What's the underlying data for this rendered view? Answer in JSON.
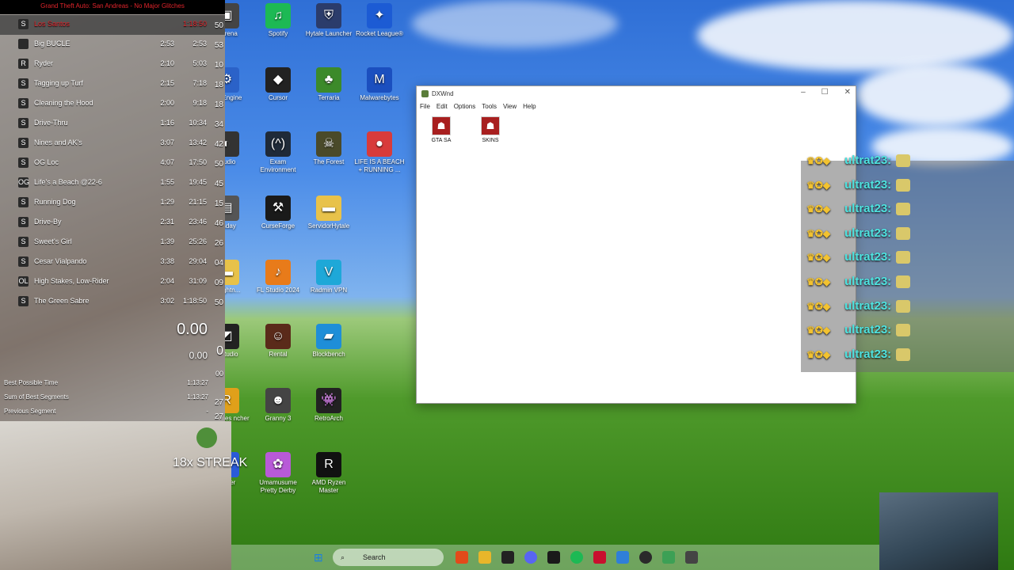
{
  "livesplit": {
    "run_title": "Grand Theft Auto: San Andreas - No Major Glitches",
    "segments": [
      {
        "icon": "S",
        "name": "Los Santos",
        "delta": "",
        "time": "1:18:50",
        "extra": "50",
        "current": true
      },
      {
        "icon": "",
        "name": "Big BUCLE",
        "delta": "2:53",
        "time": "2:53",
        "extra": "53"
      },
      {
        "icon": "R",
        "name": "Ryder",
        "delta": "2:10",
        "time": "5:03",
        "extra": "10"
      },
      {
        "icon": "S",
        "name": "Tagging up Turf",
        "delta": "2:15",
        "time": "7:18",
        "extra": "18"
      },
      {
        "icon": "S",
        "name": "Cleaning the Hood",
        "delta": "2:00",
        "time": "9:18",
        "extra": "18"
      },
      {
        "icon": "S",
        "name": "Drive-Thru",
        "delta": "1:16",
        "time": "10:34",
        "extra": "34"
      },
      {
        "icon": "S",
        "name": "Nines and AK's",
        "delta": "3:07",
        "time": "13:42",
        "extra": "42"
      },
      {
        "icon": "S",
        "name": "OG Loc",
        "delta": "4:07",
        "time": "17:50",
        "extra": "50"
      },
      {
        "icon": "OG",
        "name": "Life's a Beach @22-6",
        "delta": "1:55",
        "time": "19:45",
        "extra": "45"
      },
      {
        "icon": "S",
        "name": "Running Dog",
        "delta": "1:29",
        "time": "21:15",
        "extra": "15"
      },
      {
        "icon": "S",
        "name": "Drive-By",
        "delta": "2:31",
        "time": "23:46",
        "extra": "46"
      },
      {
        "icon": "S",
        "name": "Sweet's Girl",
        "delta": "1:39",
        "time": "25:26",
        "extra": "26"
      },
      {
        "icon": "S",
        "name": "Cesar Vialpando",
        "delta": "3:38",
        "time": "29:04",
        "extra": "04"
      },
      {
        "icon": "OL",
        "name": "High Stakes, Low-Rider",
        "delta": "2:04",
        "time": "31:09",
        "extra": "09"
      },
      {
        "icon": "S",
        "name": "The Green Sabre",
        "delta": "3:02",
        "time": "1:18:50",
        "extra": "50"
      }
    ],
    "timer_main": "0.00",
    "timer_segment": "0.00",
    "right_col": [
      "0",
      "00",
      "27",
      "27"
    ],
    "stats": [
      {
        "label": "Best Possible Time",
        "value": "1:13:27"
      },
      {
        "label": "Sum of Best Segments",
        "value": "1:13:27"
      },
      {
        "label": "Previous Segment",
        "value": "-"
      }
    ]
  },
  "streak_text": "18x STREAK",
  "desktop_icons": [
    {
      "label": "e Arena",
      "glyph": "▣",
      "color": "#444444"
    },
    {
      "label": "Spotify",
      "glyph": "♫",
      "color": "#1db954"
    },
    {
      "label": "Hytale Launcher",
      "glyph": "⛨",
      "color": "#2b3c6b"
    },
    {
      "label": "Rocket League®",
      "glyph": "✦",
      "color": "#1c5bd4"
    },
    {
      "label": "ber Engine",
      "glyph": "⚙",
      "color": "#2b62c8"
    },
    {
      "label": "Cursor",
      "glyph": "◆",
      "color": "#222222"
    },
    {
      "label": "Terraria",
      "glyph": "♣",
      "color": "#3c8a2a"
    },
    {
      "label": "Malwarebytes",
      "glyph": "M",
      "color": "#1b4fbf"
    },
    {
      "label": "Studio",
      "glyph": "◐",
      "color": "#333333"
    },
    {
      "label": "Exam Environment",
      "glyph": "(^)",
      "color": "#1f2a38"
    },
    {
      "label": "The Forest",
      "glyph": "☠",
      "color": "#4a4a2a"
    },
    {
      "label": "LIFE IS A BEACH + RUNNING ...",
      "glyph": "●",
      "color": "#d83b3b"
    },
    {
      "label": "msday",
      "glyph": "▤",
      "color": "#555555"
    },
    {
      "label": "CurseForge",
      "glyph": "⚒",
      "color": "#1a1a1a"
    },
    {
      "label": "ServidorHytale",
      "glyph": "▬",
      "color": "#e8c24a"
    },
    {
      "label": "unlightn...",
      "glyph": "▬",
      "color": "#e8c24a"
    },
    {
      "label": "FL Studio 2024",
      "glyph": "♪",
      "color": "#e87b1a"
    },
    {
      "label": "Radmin VPN",
      "glyph": "V",
      "color": "#1ea8d8"
    },
    {
      "label": "x Studio",
      "glyph": "◩",
      "color": "#222222"
    },
    {
      "label": "Rental",
      "glyph": "☺",
      "color": "#5a2a1a"
    },
    {
      "label": "Blockbench",
      "glyph": "▰",
      "color": "#1e8ed8"
    },
    {
      "label": "ar Games ncher",
      "glyph": "R",
      "color": "#e0a01a"
    },
    {
      "label": "Granny 3",
      "glyph": "☻",
      "color": "#444444"
    },
    {
      "label": "RetroArch",
      "glyph": "👾",
      "color": "#222222"
    },
    {
      "label": "Player",
      "glyph": "▶",
      "color": "#2a5bd8"
    },
    {
      "label": "Umamusume Pretty Derby",
      "glyph": "✿",
      "color": "#b85ad8"
    },
    {
      "label": "AMD Ryzen Master",
      "glyph": "R",
      "color": "#111111"
    }
  ],
  "dxwnd": {
    "title": "DXWnd",
    "menu": [
      "File",
      "Edit",
      "Options",
      "Tools",
      "View",
      "Help"
    ],
    "items": [
      {
        "label": "GTA SA"
      },
      {
        "label": "SKINS"
      }
    ]
  },
  "chat": {
    "username": "ultrat23:",
    "count": 9,
    "username_color": "#4fe3e0"
  },
  "taskbar": {
    "search_placeholder": "Search"
  }
}
